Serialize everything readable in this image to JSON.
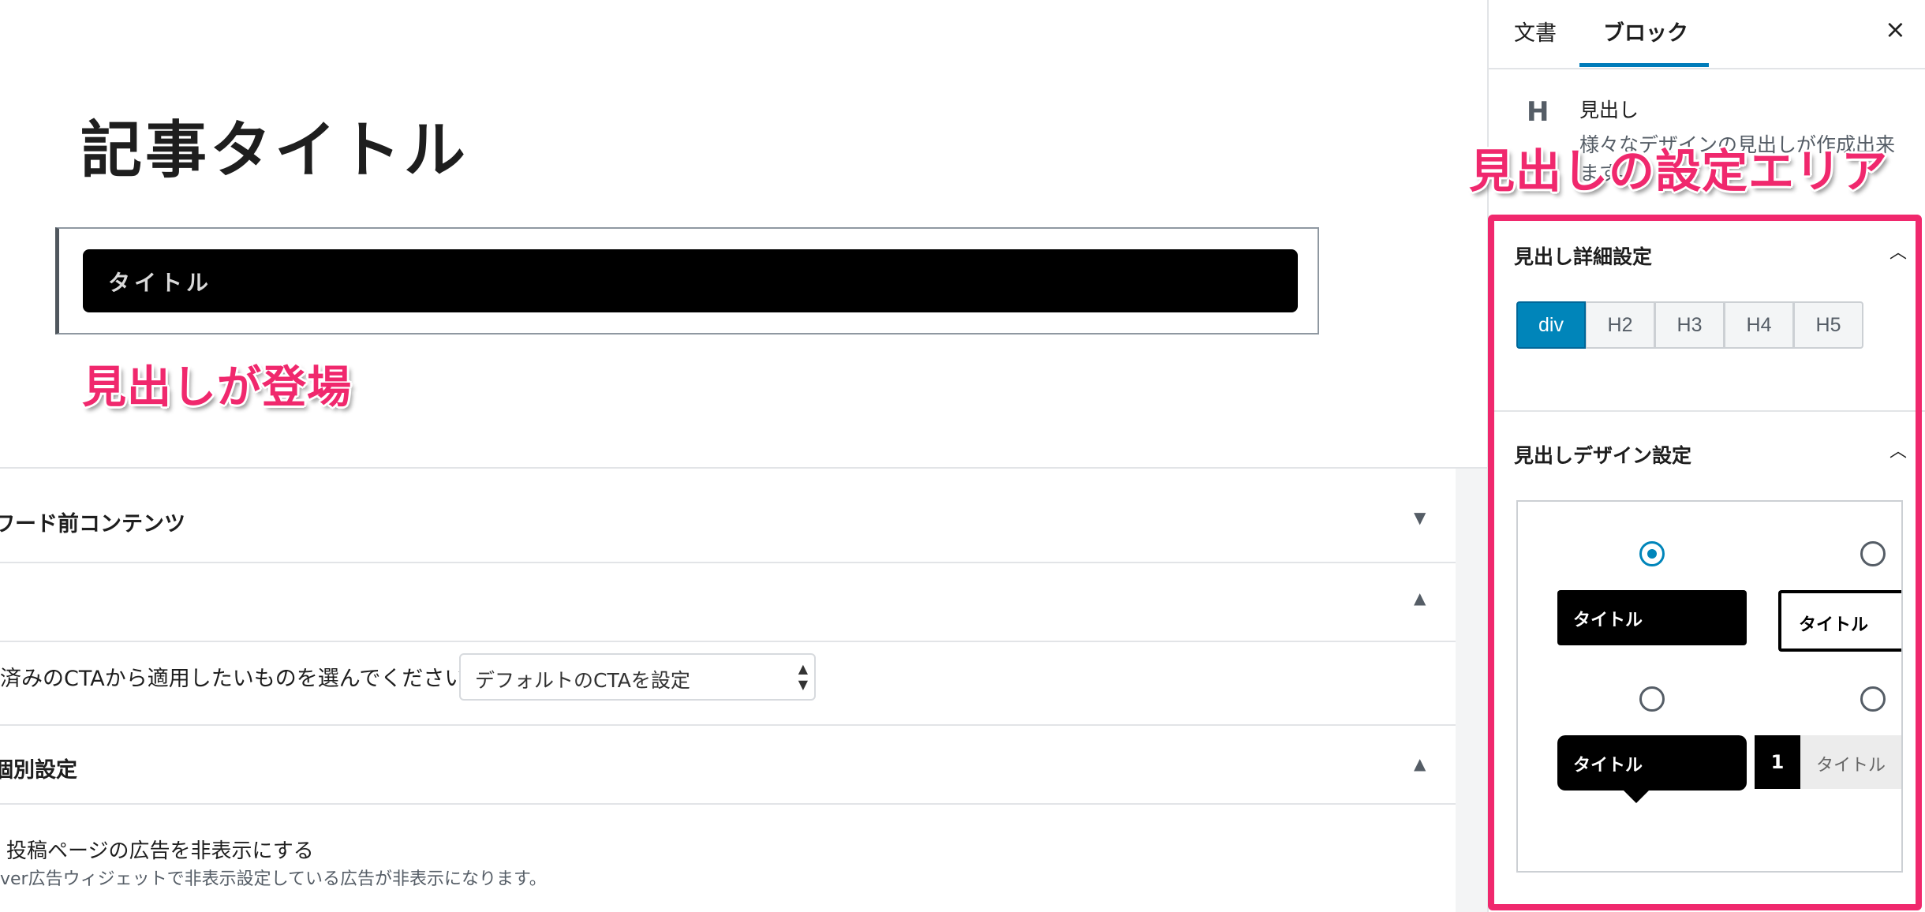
{
  "editor": {
    "post_title": "記事タイトル",
    "heading_block_text": "タイトル",
    "callout_main": "見出しが登場"
  },
  "meta_boxes": {
    "panel1_title": "ワード前コンテンツ",
    "panel1_arrow": "▼",
    "panel2_arrow": "▲",
    "cta_label": "済みのCTAから適用したいものを選んでください。",
    "cta_select_value": "デフォルトのCTAを設定",
    "panel3_title": "個別設定",
    "panel3_arrow": "▲",
    "ad_checkbox_label": "投稿ページの広告を非表示にする",
    "ad_description": "ver広告ウィジェットで非表示設定している広告が非表示になります。"
  },
  "sidebar": {
    "tabs": [
      {
        "label": "文書",
        "active": false
      },
      {
        "label": "ブロック",
        "active": true
      }
    ],
    "close_icon": "×",
    "block_card": {
      "icon_label": "H",
      "title": "見出し",
      "description": "様々なデザインの見出しが作成出来ます。"
    },
    "callout_side": "見出しの設定エリア",
    "section_detail": {
      "title": "見出し詳細設定",
      "tags": [
        "div",
        "H2",
        "H3",
        "H4",
        "H5"
      ],
      "active_tag": "div"
    },
    "section_design": {
      "title": "見出しデザイン設定",
      "samples": [
        {
          "label": "タイトル",
          "selected": true
        },
        {
          "label": "タイトル",
          "selected": false
        },
        {
          "label": "タイトル",
          "selected": false
        },
        {
          "number": "1",
          "label": "タイトル",
          "selected": false
        }
      ]
    }
  },
  "colors": {
    "accent_blue": "#0085ba",
    "highlight_pink": "#f0286d"
  }
}
